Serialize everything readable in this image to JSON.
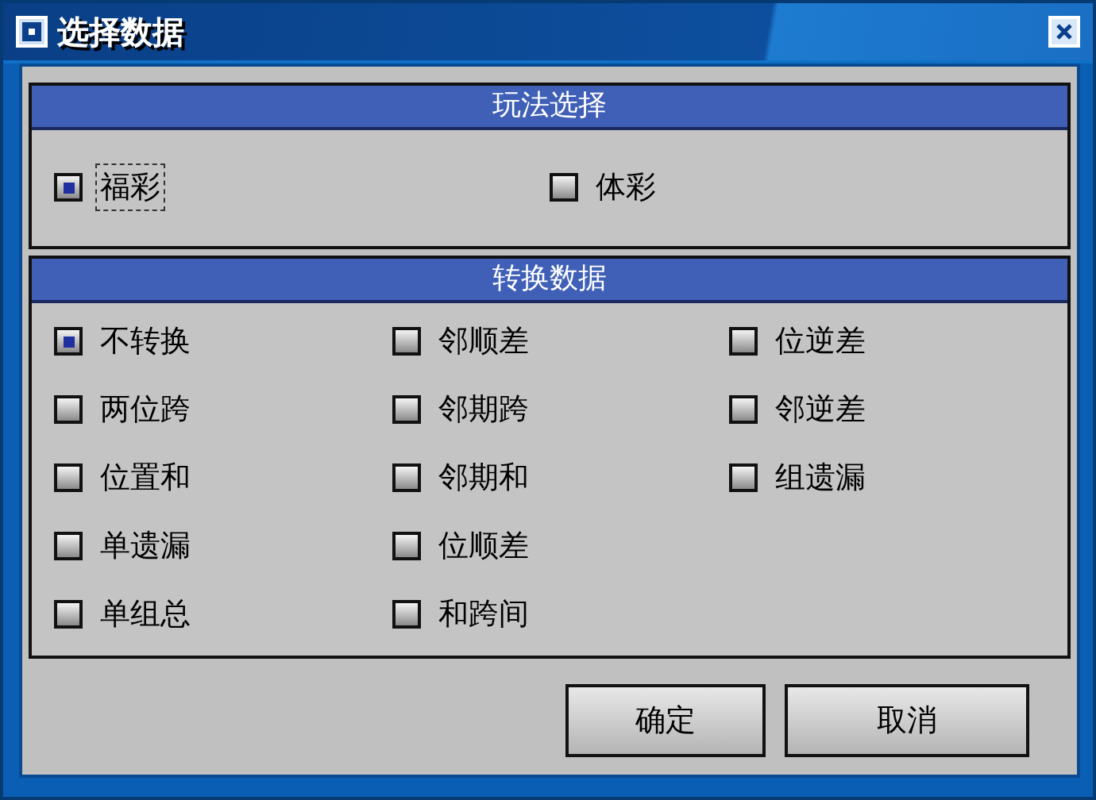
{
  "window": {
    "title": "选择数据"
  },
  "play_section": {
    "title": "玩法选择",
    "options": [
      {
        "label": "福彩",
        "checked": true,
        "focused": true
      },
      {
        "label": "体彩",
        "checked": false,
        "focused": false
      }
    ]
  },
  "convert_section": {
    "title": "转换数据",
    "options": [
      {
        "label": "不转换",
        "checked": true
      },
      {
        "label": "邻顺差",
        "checked": false
      },
      {
        "label": "位逆差",
        "checked": false
      },
      {
        "label": "两位跨",
        "checked": false
      },
      {
        "label": "邻期跨",
        "checked": false
      },
      {
        "label": "邻逆差",
        "checked": false
      },
      {
        "label": "位置和",
        "checked": false
      },
      {
        "label": "邻期和",
        "checked": false
      },
      {
        "label": "组遗漏",
        "checked": false
      },
      {
        "label": "单遗漏",
        "checked": false
      },
      {
        "label": "位顺差",
        "checked": false
      },
      {
        "label": "单组总",
        "checked": false
      },
      {
        "label": "和跨间",
        "checked": false
      }
    ]
  },
  "buttons": [
    "确定",
    "取消"
  ]
}
